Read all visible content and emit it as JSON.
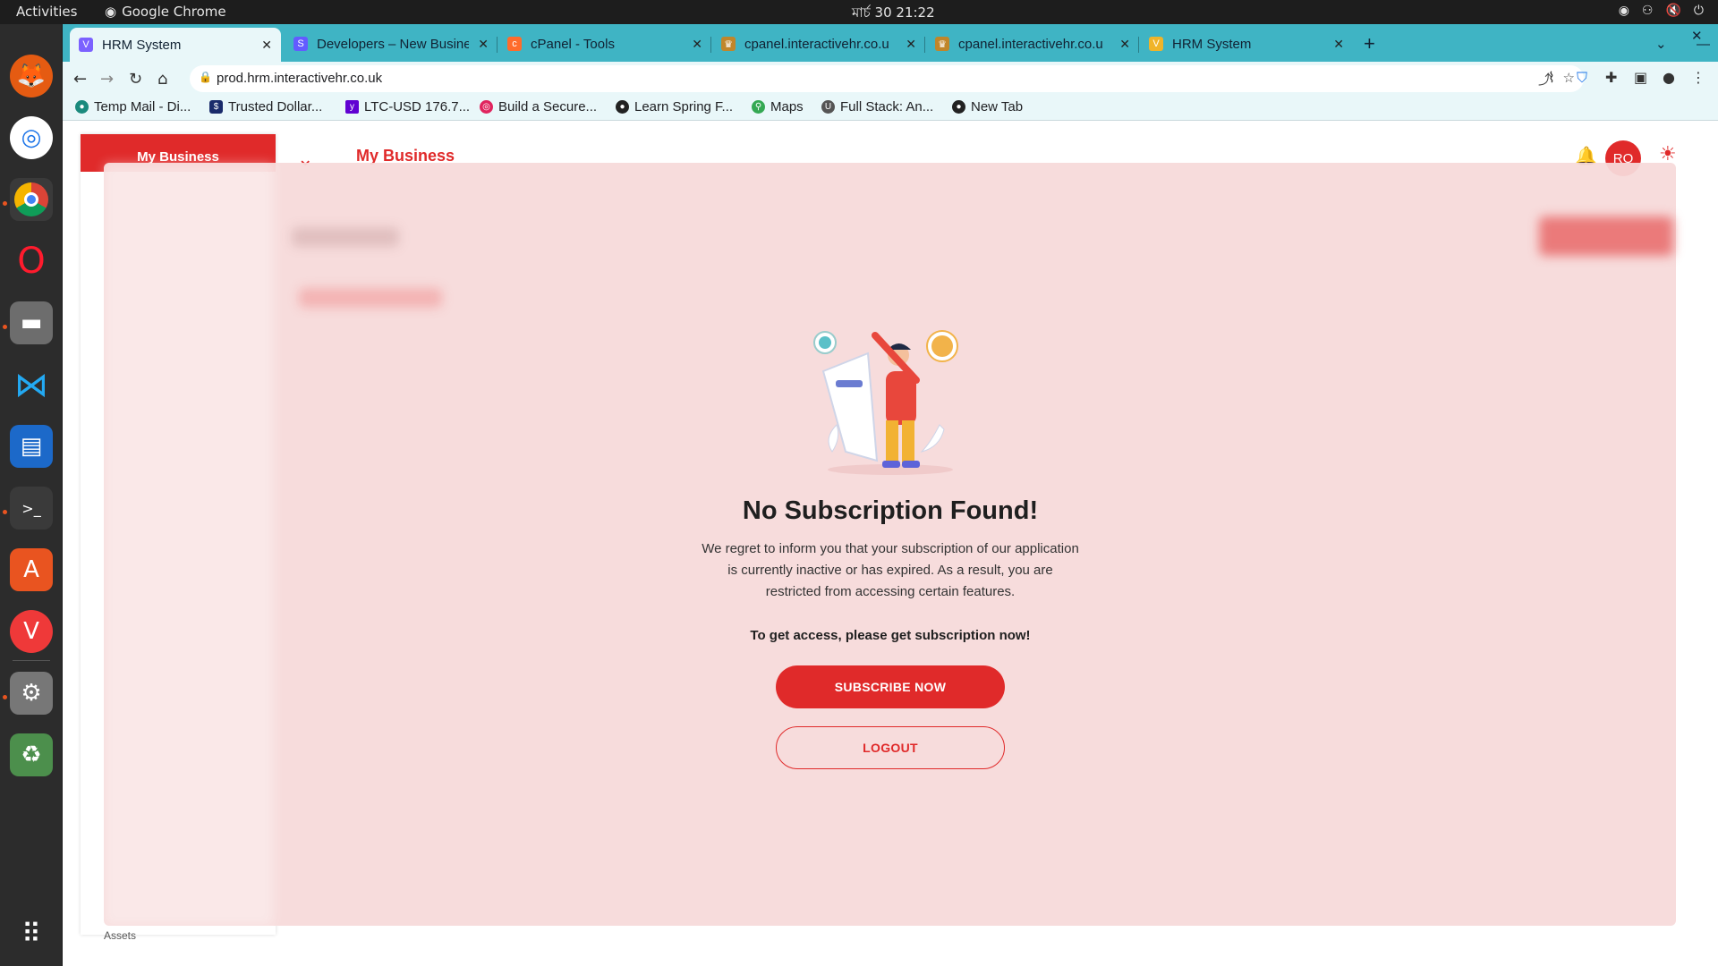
{
  "os": {
    "activities": "Activities",
    "app_name": "Google Chrome",
    "clock": "মার্চ 30  21:22"
  },
  "browser": {
    "tabs": [
      {
        "title": "HRM System",
        "active": true
      },
      {
        "title": "Developers – New Busine",
        "active": false
      },
      {
        "title": "cPanel - Tools",
        "active": false
      },
      {
        "title": "cpanel.interactivehr.co.u",
        "active": false
      },
      {
        "title": "cpanel.interactivehr.co.u",
        "active": false
      },
      {
        "title": "HRM System",
        "active": false
      }
    ],
    "url": "prod.hrm.interactivehr.co.uk",
    "bookmarks": [
      "Temp Mail - Di...",
      "Trusted Dollar...",
      "LTC-USD 176.7...",
      "Build a Secure...",
      "Learn Spring F...",
      "Maps",
      "Full Stack: An...",
      "New Tab"
    ]
  },
  "app": {
    "sidebar_brand": "My Business",
    "header_title": "My Business",
    "avatar_initials": "RO",
    "sidebar_last_item": "Assets"
  },
  "modal": {
    "title": "No Subscription Found!",
    "description": "We regret to inform you that your subscription of our application is currently inactive or has expired. As a result, you are restricted from accessing certain features.",
    "cta_text": "To get access, please get subscription now!",
    "subscribe_label": "SUBSCRIBE NOW",
    "logout_label": "LOGOUT"
  },
  "colors": {
    "accent": "#e02a2a",
    "overlay": "#f6dada",
    "tabbar": "#3fb4c4"
  }
}
